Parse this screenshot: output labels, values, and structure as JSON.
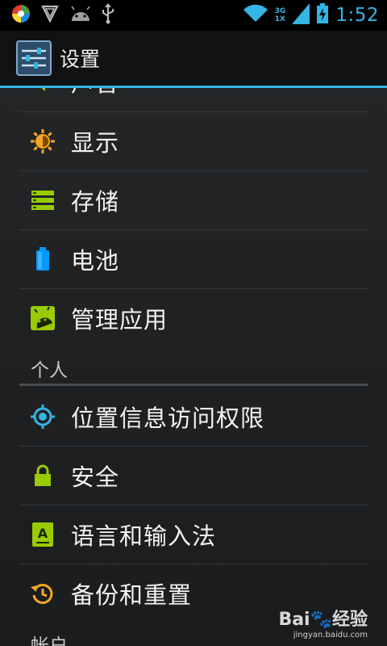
{
  "status_bar": {
    "time": "1:52",
    "network_top": "3G",
    "network_bottom": "1X",
    "icons": [
      "colorful-circle-app-icon",
      "shield-notification-icon",
      "android-debug-icon",
      "usb-icon",
      "wifi-icon",
      "signal-icon",
      "battery-charging-icon"
    ],
    "accent_color": "#33b5e5"
  },
  "action_bar": {
    "title": "设置",
    "icon": "settings-sliders-icon"
  },
  "list": {
    "partial_top_label": "声音",
    "items": [
      {
        "label": "显示",
        "icon": "brightness-icon",
        "color": "#f5a623"
      },
      {
        "label": "存储",
        "icon": "storage-icon",
        "color": "#99cc00"
      },
      {
        "label": "电池",
        "icon": "battery-icon",
        "color": "#0099ff"
      },
      {
        "label": "管理应用",
        "icon": "apps-icon",
        "color": "#99cc00"
      }
    ],
    "section_personal": "个人",
    "personal_items": [
      {
        "label": "位置信息访问权限",
        "icon": "location-icon",
        "color": "#33b5e5"
      },
      {
        "label": "安全",
        "icon": "lock-icon",
        "color": "#99cc00"
      },
      {
        "label": "语言和输入法",
        "icon": "language-icon",
        "color": "#99cc00"
      },
      {
        "label": "备份和重置",
        "icon": "backup-icon",
        "color": "#f5a623"
      }
    ],
    "section_accounts": "帐户"
  },
  "watermark": {
    "brand": "Bai🐾经验",
    "url": "jingyan.baidu.com"
  }
}
